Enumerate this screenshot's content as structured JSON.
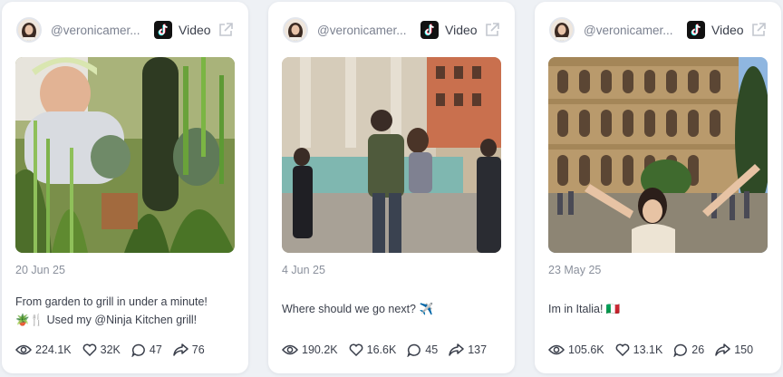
{
  "colors": {
    "background": "#eef1f5",
    "card": "#ffffff",
    "text": "#3a3f4b",
    "muted": "#8a909c"
  },
  "cards": [
    {
      "handle": "@veronicamer...",
      "platform": "Video",
      "platform_icon": "tiktok-icon",
      "date": "20 Jun 25",
      "caption_line1": "From garden to grill in under a minute!",
      "caption_line2": "🪴🍴 Used my @Ninja Kitchen grill!",
      "views": "224.1K",
      "likes": "32K",
      "comments": "47",
      "shares": "76"
    },
    {
      "handle": "@veronicamer...",
      "platform": "Video",
      "platform_icon": "tiktok-icon",
      "date": "4 Jun 25",
      "caption_line1": "Where should we go next? ✈️",
      "views": "190.2K",
      "likes": "16.6K",
      "comments": "45",
      "shares": "137"
    },
    {
      "handle": "@veronicamer...",
      "platform": "Video",
      "platform_icon": "tiktok-icon",
      "date": "23 May 25",
      "caption_line1": "Im in Italia! 🇮🇹",
      "views": "105.6K",
      "likes": "13.1K",
      "comments": "26",
      "shares": "150"
    }
  ]
}
